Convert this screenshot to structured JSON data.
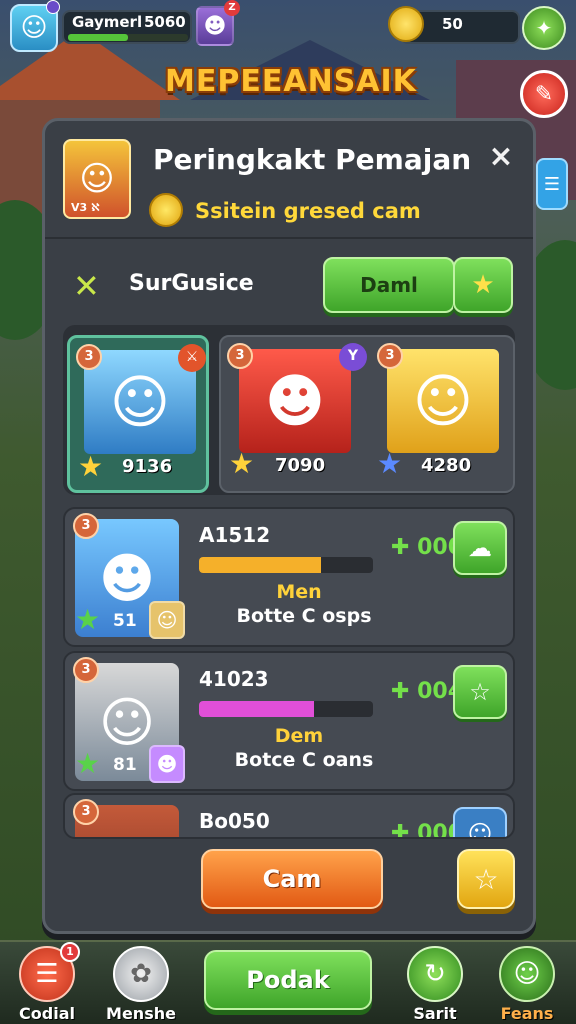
{
  "topbar": {
    "player_name": "Gaymerl",
    "player_score": "5060",
    "xp_progress": 0.5,
    "hero_badge": "Z",
    "coins": "50"
  },
  "banner": {
    "title": "MEPEEANSAIK"
  },
  "modal": {
    "title": "Peringkakt Pemajan",
    "subtitle": "Ssitein gresed cam",
    "close_icon": "×",
    "header_avatar_label": "V3 ℵ",
    "filter_label": "SurGusice",
    "filter_button": "Daml",
    "top_heroes": [
      {
        "rank": "3",
        "score": "9136"
      },
      {
        "rank": "3",
        "score": "7090"
      },
      {
        "rank": "3",
        "score": "4280"
      }
    ],
    "rows": [
      {
        "rank": "3",
        "name": "A1512",
        "level": "51",
        "tag": "Men",
        "desc": "Botte C osps",
        "score": "000",
        "bar_color": "#f5b02a",
        "progress": 0.7
      },
      {
        "rank": "3",
        "name": "41023",
        "level": "81",
        "tag": "Dem",
        "desc": "Botce C oans",
        "score": "004",
        "bar_color": "#e14fd8",
        "progress": 0.66
      },
      {
        "rank": "3",
        "name": "Bo050",
        "level": "",
        "tag": "",
        "desc": "",
        "score": "000",
        "bar_color": "#f5b02a",
        "progress": 0
      }
    ],
    "cam_button": "Cam"
  },
  "nav": {
    "items": [
      {
        "label": "Codial",
        "badge": "1"
      },
      {
        "label": "Menshe"
      },
      {
        "label": "Sarit"
      },
      {
        "label": "Feans"
      }
    ],
    "main_button": "Podak"
  },
  "colors": {
    "accent_green": "#3fa52a",
    "accent_orange": "#e25a14",
    "gold": "#ffd23a"
  }
}
